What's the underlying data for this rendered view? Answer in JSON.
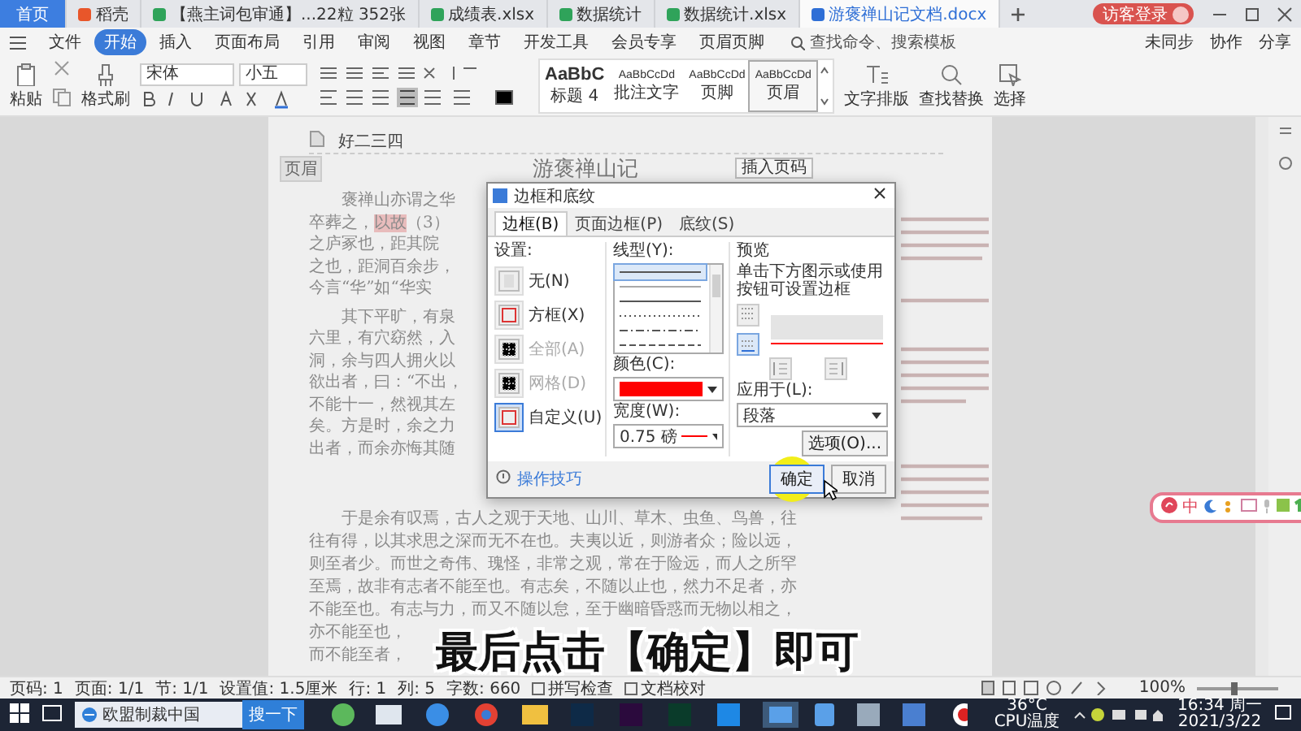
{
  "tabs": [
    {
      "label": "首页",
      "kind": "home",
      "selected": false
    },
    {
      "label": "稻壳",
      "kind": "docer",
      "selected": false
    },
    {
      "label": "【燕主词包审通】...22粒 352张",
      "kind": "sheet",
      "selected": false
    },
    {
      "label": "成绩表.xlsx",
      "kind": "sheet",
      "selected": false
    },
    {
      "label": "数据统计",
      "kind": "sheet",
      "selected": false
    },
    {
      "label": "数据统计.xlsx",
      "kind": "sheet",
      "selected": false
    },
    {
      "label": "游褒禅山记文档.docx",
      "kind": "word",
      "selected": true
    }
  ],
  "account_button": "访客登录",
  "menu": [
    {
      "label": "文件",
      "selected": false
    },
    {
      "label": "开始",
      "selected": true
    },
    {
      "label": "插入",
      "selected": false
    },
    {
      "label": "页面布局",
      "selected": false
    },
    {
      "label": "引用",
      "selected": false
    },
    {
      "label": "审阅",
      "selected": false
    },
    {
      "label": "视图",
      "selected": false
    },
    {
      "label": "章节",
      "selected": false
    },
    {
      "label": "开发工具",
      "selected": false
    },
    {
      "label": "会员专享",
      "selected": false
    },
    {
      "label": "页眉页脚",
      "selected": false
    }
  ],
  "command_search": {
    "placeholder": "查找命令、搜索模板"
  },
  "cloud_actions": [
    "未同步",
    "协作",
    "分享"
  ],
  "ribbon": {
    "paste": "粘贴",
    "format_painter": "格式刷",
    "font": "宋体",
    "size": "小五",
    "styles": [
      {
        "sample": "AaBbC",
        "name": "标题 4",
        "selected": false
      },
      {
        "sample": "AaBbCcDd",
        "name": "批注文字",
        "selected": false
      },
      {
        "sample": "AaBbCcDd",
        "name": "页脚",
        "selected": false
      },
      {
        "sample": "AaBbCcDd",
        "name": "页眉",
        "selected": true
      }
    ],
    "tools": [
      "文字排版",
      "查找替换",
      "选择"
    ]
  },
  "document": {
    "header_text": "好二三四",
    "header_tag": "页眉",
    "insert_page_number": "插入页码",
    "title": "游褒禅山记",
    "paragraphs": [
      {
        "lines": [
          [
            {
              "text": "褒禅山亦谓之华",
              "highlighted": false
            }
          ],
          [
            {
              "text": "卒葬之，",
              "highlighted": false
            },
            {
              "text": "以故",
              "highlighted": true
            },
            {
              "text": "（3）",
              "highlighted": false
            }
          ],
          [
            {
              "text": "之庐冢也，距其院",
              "highlighted": false
            }
          ],
          [
            {
              "text": "之也，距洞百余步，",
              "highlighted": false
            }
          ],
          [
            {
              "text": "今言“华”如“华实",
              "highlighted": false
            }
          ]
        ]
      },
      {
        "lines": [
          [
            {
              "text": "其下平旷，有泉",
              "highlighted": false
            }
          ],
          [
            {
              "text": "六里，有穴窈然，入",
              "highlighted": false
            }
          ],
          [
            {
              "text": "洞，余与四人拥火以",
              "highlighted": false
            }
          ],
          [
            {
              "text": "欲出者，曰：“不出，",
              "highlighted": false
            }
          ],
          [
            {
              "text": "不能十一，然视其左",
              "highlighted": false
            }
          ],
          [
            {
              "text": "矣。方是时，余之力",
              "highlighted": false
            }
          ],
          [
            {
              "text": "出者，而余亦悔其随",
              "highlighted": false
            }
          ]
        ]
      },
      {
        "lines": [
          [
            {
              "text": "于是余有叹焉，古人之观于天地、山川、草木、虫鱼、鸟兽，往",
              "highlighted": false
            }
          ],
          [
            {
              "text": "往有得，以其求思之深而无不在也。夫夷以近，则游者众；险以远，",
              "highlighted": false
            }
          ],
          [
            {
              "text": "则至者少。而世之奇伟、瑰怪，非常之观，常在于险远，而人之所罕",
              "highlighted": false
            }
          ],
          [
            {
              "text": "至焉，故非有志者不能至也。有志矣，不随以止也，然力不足者，亦",
              "highlighted": false
            }
          ],
          [
            {
              "text": "不能至也。有志与力，而又不随以怠，至于幽暗昏惑而无物以相之，",
              "highlighted": false
            }
          ],
          [
            {
              "text": "亦不能至也，",
              "highlighted": false
            }
          ],
          [
            {
              "text": "而不能至者，",
              "highlighted": false
            }
          ]
        ]
      }
    ]
  },
  "dialog": {
    "title": "边框和底纹",
    "tabs": [
      {
        "label": "边框(B)",
        "selected": true
      },
      {
        "label": "页面边框(P)",
        "selected": false
      },
      {
        "label": "底纹(S)",
        "selected": false
      }
    ],
    "settings_label": "设置:",
    "settings": [
      {
        "label": "无(N)",
        "kind": "none",
        "selected": false,
        "disabled": false
      },
      {
        "label": "方框(X)",
        "kind": "box",
        "selected": false,
        "disabled": false
      },
      {
        "label": "全部(A)",
        "kind": "all",
        "selected": false,
        "disabled": true
      },
      {
        "label": "网格(D)",
        "kind": "grid",
        "selected": false,
        "disabled": true
      },
      {
        "label": "自定义(U)",
        "kind": "custom",
        "selected": true,
        "disabled": false
      }
    ],
    "line_style_label": "线型(Y):",
    "line_styles": [
      {
        "kind": "solid",
        "selected": true
      },
      {
        "kind": "thin",
        "selected": false
      },
      {
        "kind": "solid",
        "selected": false
      },
      {
        "kind": "dotted",
        "selected": false
      },
      {
        "kind": "dash-dot",
        "selected": false
      },
      {
        "kind": "dashed",
        "selected": false
      }
    ],
    "color_label": "颜色(C):",
    "color": "#ff0000",
    "width_label": "宽度(W):",
    "width_value": "0.75 磅",
    "preview_label": "预览",
    "preview_hint": "单击下方图示或使用按钮可设置边框",
    "apply_label": "应用于(L):",
    "apply_value": "段落",
    "options_button": "选项(O)...",
    "tips_link": "操作技巧",
    "ok_button": "确定",
    "cancel_button": "取消"
  },
  "subtitle": "最后点击【确定】即可",
  "ime_toolbar": {
    "mode": "中"
  },
  "status_bar": {
    "items": [
      "页码: 1",
      "页面: 1/1",
      "节: 1/1",
      "设置值: 1.5厘米",
      "行: 1",
      "列: 5",
      "字数: 660"
    ],
    "spell_check": "拼写检查",
    "proofread": "文档校对",
    "zoom": "100%",
    "zoom_slider": {
      "level": 0.45
    }
  },
  "taskbar": {
    "search": {
      "placeholder": "欧盟制裁中国"
    },
    "search_button": "搜一下",
    "temperature": "36°C",
    "temperature_label": "CPU温度",
    "time": "16:34 周一",
    "date": "2021/3/22"
  }
}
